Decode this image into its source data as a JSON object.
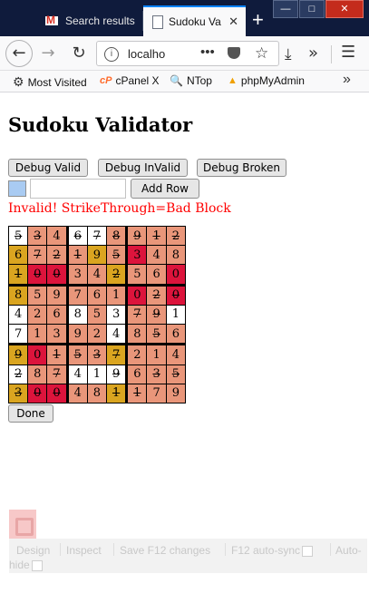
{
  "browser": {
    "tabs": [
      {
        "label": "Search results",
        "icon": "gmail-icon",
        "active": false
      },
      {
        "label": "Sudoku Va",
        "icon": "page-icon",
        "active": true
      }
    ],
    "new_tab_glyph": "+",
    "tab_close_glyph": "✕",
    "url": "localho",
    "url_more": "•••",
    "bookmarks": [
      {
        "label": "Most Visited",
        "icon": "gear-icon"
      },
      {
        "label": "cPanel X",
        "icon": "cpanel-icon"
      },
      {
        "label": "NTop",
        "icon": "search-icon"
      },
      {
        "label": "phpMyAdmin",
        "icon": "phpmyadmin-icon"
      }
    ],
    "bookmarks_more": "»"
  },
  "page": {
    "title": "Sudoku Validator",
    "buttons": {
      "debug_valid": "Debug Valid",
      "debug_invalid": "Debug InValid",
      "debug_broken": "Debug Broken",
      "add_row": "Add Row",
      "done": "Done"
    },
    "row_input_value": "",
    "status": "Invalid! StrikeThrough=Bad Block",
    "status_color": "#ff0000",
    "swatch_color": "#a9cbf2",
    "grid": [
      [
        {
          "v": "5",
          "s": true,
          "c": "#ffffff"
        },
        {
          "v": "3",
          "s": true,
          "c": "#e9967a"
        },
        {
          "v": "4",
          "s": false,
          "c": "#e9967a"
        },
        {
          "v": "6",
          "s": true,
          "c": "#ffffff"
        },
        {
          "v": "7",
          "s": true,
          "c": "#ffffff"
        },
        {
          "v": "8",
          "s": true,
          "c": "#e9967a"
        },
        {
          "v": "9",
          "s": true,
          "c": "#e9967a"
        },
        {
          "v": "1",
          "s": true,
          "c": "#e9967a"
        },
        {
          "v": "2",
          "s": true,
          "c": "#e9967a"
        }
      ],
      [
        {
          "v": "6",
          "s": false,
          "c": "#daa520"
        },
        {
          "v": "7",
          "s": true,
          "c": "#e9967a"
        },
        {
          "v": "2",
          "s": true,
          "c": "#e9967a"
        },
        {
          "v": "1",
          "s": true,
          "c": "#e9967a"
        },
        {
          "v": "9",
          "s": false,
          "c": "#daa520"
        },
        {
          "v": "5",
          "s": true,
          "c": "#e9967a"
        },
        {
          "v": "3",
          "s": false,
          "c": "#dc143c"
        },
        {
          "v": "4",
          "s": false,
          "c": "#e9967a"
        },
        {
          "v": "8",
          "s": false,
          "c": "#e9967a"
        }
      ],
      [
        {
          "v": "1",
          "s": true,
          "c": "#daa520"
        },
        {
          "v": "0",
          "s": true,
          "c": "#dc143c"
        },
        {
          "v": "0",
          "s": true,
          "c": "#dc143c"
        },
        {
          "v": "3",
          "s": false,
          "c": "#e9967a"
        },
        {
          "v": "4",
          "s": false,
          "c": "#e9967a"
        },
        {
          "v": "2",
          "s": true,
          "c": "#daa520"
        },
        {
          "v": "5",
          "s": false,
          "c": "#e9967a"
        },
        {
          "v": "6",
          "s": false,
          "c": "#e9967a"
        },
        {
          "v": "0",
          "s": false,
          "c": "#dc143c"
        }
      ],
      [
        {
          "v": "8",
          "s": false,
          "c": "#daa520"
        },
        {
          "v": "5",
          "s": false,
          "c": "#e9967a"
        },
        {
          "v": "9",
          "s": false,
          "c": "#e9967a"
        },
        {
          "v": "7",
          "s": false,
          "c": "#e9967a"
        },
        {
          "v": "6",
          "s": false,
          "c": "#e9967a"
        },
        {
          "v": "1",
          "s": false,
          "c": "#e9967a"
        },
        {
          "v": "0",
          "s": false,
          "c": "#dc143c"
        },
        {
          "v": "2",
          "s": true,
          "c": "#e9967a"
        },
        {
          "v": "0",
          "s": true,
          "c": "#dc143c"
        }
      ],
      [
        {
          "v": "4",
          "s": false,
          "c": "#ffffff"
        },
        {
          "v": "2",
          "s": false,
          "c": "#e9967a"
        },
        {
          "v": "6",
          "s": false,
          "c": "#e9967a"
        },
        {
          "v": "8",
          "s": false,
          "c": "#ffffff"
        },
        {
          "v": "5",
          "s": false,
          "c": "#e9967a"
        },
        {
          "v": "3",
          "s": false,
          "c": "#ffffff"
        },
        {
          "v": "7",
          "s": true,
          "c": "#e9967a"
        },
        {
          "v": "9",
          "s": true,
          "c": "#e9967a"
        },
        {
          "v": "1",
          "s": false,
          "c": "#ffffff"
        }
      ],
      [
        {
          "v": "7",
          "s": false,
          "c": "#ffffff"
        },
        {
          "v": "1",
          "s": false,
          "c": "#e9967a"
        },
        {
          "v": "3",
          "s": false,
          "c": "#e9967a"
        },
        {
          "v": "9",
          "s": false,
          "c": "#e9967a"
        },
        {
          "v": "2",
          "s": false,
          "c": "#e9967a"
        },
        {
          "v": "4",
          "s": false,
          "c": "#ffffff"
        },
        {
          "v": "8",
          "s": false,
          "c": "#e9967a"
        },
        {
          "v": "5",
          "s": true,
          "c": "#e9967a"
        },
        {
          "v": "6",
          "s": false,
          "c": "#e9967a"
        }
      ],
      [
        {
          "v": "9",
          "s": true,
          "c": "#daa520"
        },
        {
          "v": "0",
          "s": false,
          "c": "#dc143c"
        },
        {
          "v": "1",
          "s": true,
          "c": "#e9967a"
        },
        {
          "v": "5",
          "s": true,
          "c": "#e9967a"
        },
        {
          "v": "3",
          "s": true,
          "c": "#e9967a"
        },
        {
          "v": "7",
          "s": true,
          "c": "#daa520"
        },
        {
          "v": "2",
          "s": false,
          "c": "#e9967a"
        },
        {
          "v": "1",
          "s": false,
          "c": "#e9967a"
        },
        {
          "v": "4",
          "s": false,
          "c": "#e9967a"
        }
      ],
      [
        {
          "v": "2",
          "s": true,
          "c": "#ffffff"
        },
        {
          "v": "8",
          "s": false,
          "c": "#e9967a"
        },
        {
          "v": "7",
          "s": true,
          "c": "#e9967a"
        },
        {
          "v": "4",
          "s": false,
          "c": "#ffffff"
        },
        {
          "v": "1",
          "s": false,
          "c": "#ffffff"
        },
        {
          "v": "9",
          "s": true,
          "c": "#ffffff"
        },
        {
          "v": "6",
          "s": false,
          "c": "#e9967a"
        },
        {
          "v": "3",
          "s": true,
          "c": "#e9967a"
        },
        {
          "v": "5",
          "s": true,
          "c": "#e9967a"
        }
      ],
      [
        {
          "v": "3",
          "s": true,
          "c": "#daa520"
        },
        {
          "v": "0",
          "s": true,
          "c": "#dc143c"
        },
        {
          "v": "0",
          "s": true,
          "c": "#dc143c"
        },
        {
          "v": "4",
          "s": false,
          "c": "#e9967a"
        },
        {
          "v": "8",
          "s": false,
          "c": "#e9967a"
        },
        {
          "v": "1",
          "s": true,
          "c": "#daa520"
        },
        {
          "v": "1",
          "s": true,
          "c": "#e9967a"
        },
        {
          "v": "7",
          "s": false,
          "c": "#e9967a"
        },
        {
          "v": "9",
          "s": false,
          "c": "#e9967a"
        }
      ]
    ]
  },
  "devtools": {
    "logo_icon": "visual-studio-icon",
    "items": [
      "Design",
      "Inspect",
      "Save F12 changes",
      "F12 auto-sync",
      "Auto-",
      "hide"
    ]
  }
}
